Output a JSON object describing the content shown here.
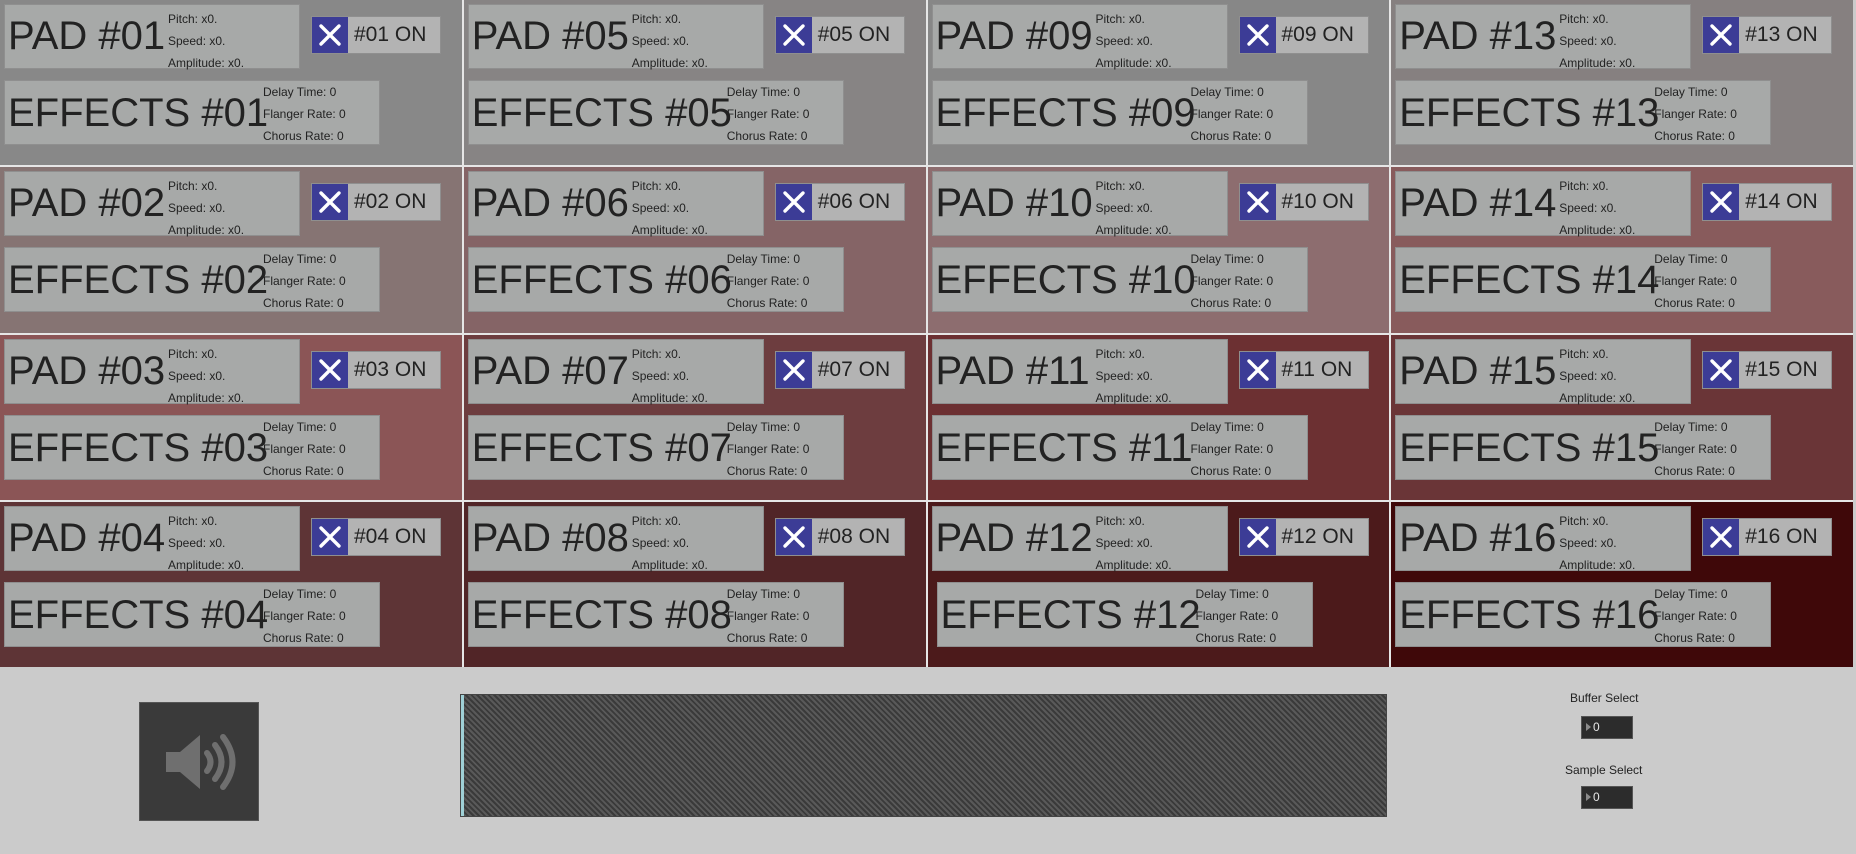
{
  "pads": [
    {
      "pad_title": "PAD #01",
      "pitch": "Pitch: x0.",
      "speed": "Speed: x0.",
      "amplitude": "Amplitude: x0.",
      "toggle_label": "#01  ON",
      "effects_title": "EFFECTS #01",
      "delay": "Delay Time: 0",
      "flanger": "Flanger Rate: 0",
      "chorus": "Chorus Rate: 0",
      "bg": "#888888"
    },
    {
      "pad_title": "PAD #02",
      "pitch": "Pitch: x0.",
      "speed": "Speed: x0.",
      "amplitude": "Amplitude: x0.",
      "toggle_label": "#02  ON",
      "effects_title": "EFFECTS #02",
      "delay": "Delay Time: 0",
      "flanger": "Flanger Rate: 0",
      "chorus": "Chorus Rate: 0",
      "bg": "#867473"
    },
    {
      "pad_title": "PAD #03",
      "pitch": "Pitch: x0.",
      "speed": "Speed: x0.",
      "amplitude": "Amplitude: x0.",
      "toggle_label": "#03  ON",
      "effects_title": "EFFECTS #03",
      "delay": "Delay Time: 0",
      "flanger": "Flanger Rate: 0",
      "chorus": "Chorus Rate: 0",
      "bg": "#8b5556"
    },
    {
      "pad_title": "PAD #04",
      "pitch": "Pitch: x0.",
      "speed": "Speed: x0.",
      "amplitude": "Amplitude: x0.",
      "toggle_label": "#04  ON",
      "effects_title": "EFFECTS #04",
      "delay": "Delay Time: 0",
      "flanger": "Flanger Rate: 0",
      "chorus": "Chorus Rate: 0",
      "bg": "#5e3436"
    },
    {
      "pad_title": "PAD #05",
      "pitch": "Pitch: x0.",
      "speed": "Speed: x0.",
      "amplitude": "Amplitude: x0.",
      "toggle_label": "#05  ON",
      "effects_title": "EFFECTS #05",
      "delay": "Delay Time: 0",
      "flanger": "Flanger Rate: 0",
      "chorus": "Chorus Rate: 0",
      "bg": "#878484"
    },
    {
      "pad_title": "PAD #06",
      "pitch": "Pitch: x0.",
      "speed": "Speed: x0.",
      "amplitude": "Amplitude: x0.",
      "toggle_label": "#06  ON",
      "effects_title": "EFFECTS #06",
      "delay": "Delay Time: 0",
      "flanger": "Flanger Rate: 0",
      "chorus": "Chorus Rate: 0",
      "bg": "#856466"
    },
    {
      "pad_title": "PAD #07",
      "pitch": "Pitch: x0.",
      "speed": "Speed: x0.",
      "amplitude": "Amplitude: x0.",
      "toggle_label": "#07  ON",
      "effects_title": "EFFECTS #07",
      "delay": "Delay Time: 0",
      "flanger": "Flanger Rate: 0",
      "chorus": "Chorus Rate: 0",
      "bg": "#6d3d3f"
    },
    {
      "pad_title": "PAD #08",
      "pitch": "Pitch: x0.",
      "speed": "Speed: x0.",
      "amplitude": "Amplitude: x0.",
      "toggle_label": "#08  ON",
      "effects_title": "EFFECTS #08",
      "delay": "Delay Time: 0",
      "flanger": "Flanger Rate: 0",
      "chorus": "Chorus Rate: 0",
      "bg": "#512527"
    },
    {
      "pad_title": "PAD #09",
      "pitch": "Pitch: x0.",
      "speed": "Speed: x0.",
      "amplitude": "Amplitude: x0.",
      "toggle_label": "#09  ON",
      "effects_title": "EFFECTS #09",
      "delay": "Delay Time: 0",
      "flanger": "Flanger Rate: 0",
      "chorus": "Chorus Rate: 0",
      "bg": "#878787"
    },
    {
      "pad_title": "PAD #10",
      "pitch": "Pitch: x0.",
      "speed": "Speed: x0.",
      "amplitude": "Amplitude: x0.",
      "toggle_label": "#10  ON",
      "effects_title": "EFFECTS #10",
      "delay": "Delay Time: 0",
      "flanger": "Flanger Rate: 0",
      "chorus": "Chorus Rate: 0",
      "bg": "#8d6d6f"
    },
    {
      "pad_title": "PAD #11",
      "pitch": "Pitch: x0.",
      "speed": "Speed: x0.",
      "amplitude": "Amplitude: x0.",
      "toggle_label": "#11  ON",
      "effects_title": "EFFECTS #11",
      "delay": "Delay Time: 0",
      "flanger": "Flanger Rate: 0",
      "chorus": "Chorus Rate: 0",
      "bg": "#6c3032"
    },
    {
      "pad_title": "PAD #12",
      "pitch": "Pitch: x0.",
      "speed": "Speed: x0.",
      "amplitude": "Amplitude: x0.",
      "toggle_label": "#12  ON",
      "effects_title": "EFFECTS #12",
      "delay": "Delay Time: 0",
      "flanger": "Flanger Rate: 0",
      "chorus": "Chorus Rate: 0",
      "bg": "#4c1a1b"
    },
    {
      "pad_title": "PAD #13",
      "pitch": "Pitch: x0.",
      "speed": "Speed: x0.",
      "amplitude": "Amplitude: x0.",
      "toggle_label": "#13  ON",
      "effects_title": "EFFECTS #13",
      "delay": "Delay Time: 0",
      "flanger": "Flanger Rate: 0",
      "chorus": "Chorus Rate: 0",
      "bg": "#868080"
    },
    {
      "pad_title": "PAD #14",
      "pitch": "Pitch: x0.",
      "speed": "Speed: x0.",
      "amplitude": "Amplitude: x0.",
      "toggle_label": "#14  ON",
      "effects_title": "EFFECTS #14",
      "delay": "Delay Time: 0",
      "flanger": "Flanger Rate: 0",
      "chorus": "Chorus Rate: 0",
      "bg": "#885b5c"
    },
    {
      "pad_title": "PAD #15",
      "pitch": "Pitch: x0.",
      "speed": "Speed: x0.",
      "amplitude": "Amplitude: x0.",
      "toggle_label": "#15  ON",
      "effects_title": "EFFECTS #15",
      "delay": "Delay Time: 0",
      "flanger": "Flanger Rate: 0",
      "chorus": "Chorus Rate: 0",
      "bg": "#6a3537"
    },
    {
      "pad_title": "PAD #16",
      "pitch": "Pitch: x0.",
      "speed": "Speed: x0.",
      "amplitude": "Amplitude: x0.",
      "toggle_label": "#16  ON",
      "effects_title": "EFFECTS #16",
      "delay": "Delay Time: 0",
      "flanger": "Flanger Rate: 0",
      "chorus": "Chorus Rate: 0",
      "bg": "#3f0809"
    }
  ],
  "colors": {
    "toggle_accent": "#3c3c96",
    "panel": "#a7a9a8",
    "footer": "#cbcbcb"
  },
  "footer": {
    "speaker_icon": "speaker-volume-icon",
    "buffer_select_label": "Buffer Select",
    "buffer_select_value": "0",
    "sample_select_label": "Sample Select",
    "sample_select_value": "0"
  }
}
